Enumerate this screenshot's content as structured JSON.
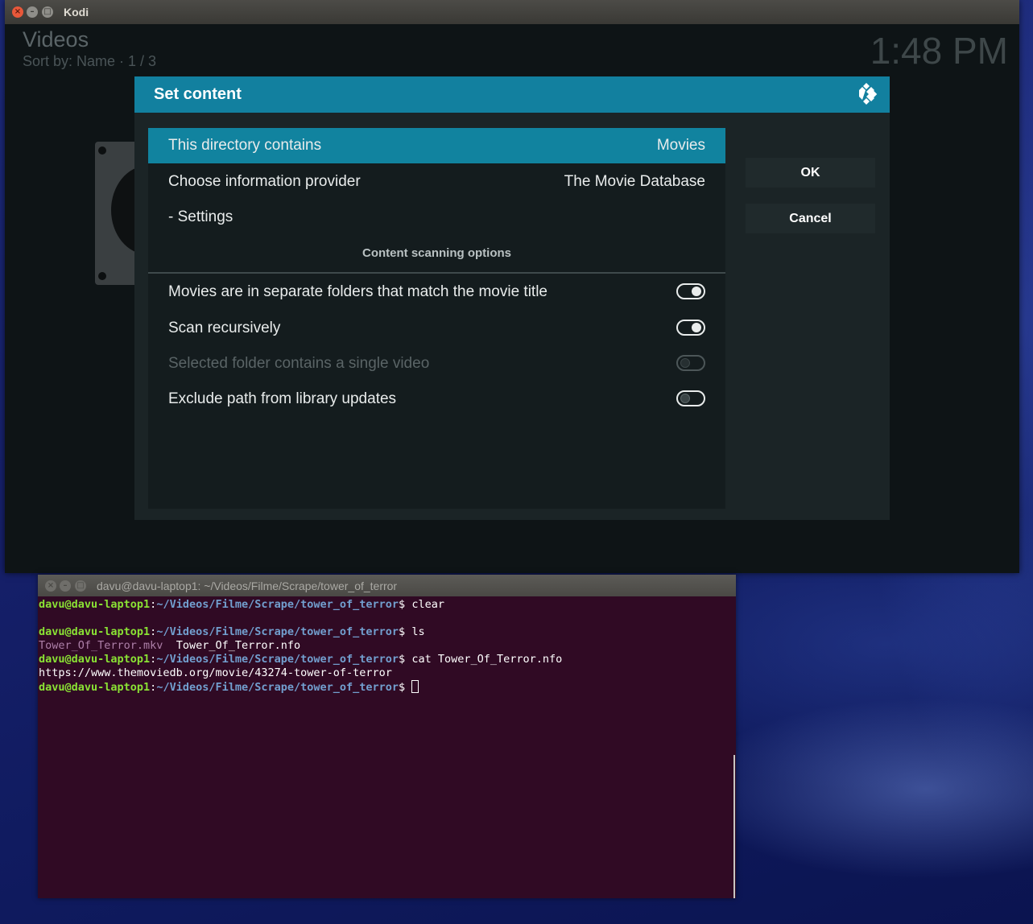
{
  "kodi": {
    "window_title": "Kodi",
    "background": {
      "heading": "Videos",
      "sort_info": "Sort by: Name  ·  1 / 3",
      "clock": "1:48 PM"
    },
    "dialog": {
      "title": "Set content",
      "rows": [
        {
          "label": "This directory contains",
          "value": "Movies"
        },
        {
          "label": "Choose information provider",
          "value": "The Movie Database"
        },
        {
          "label": "- Settings"
        }
      ],
      "section_title": "Content scanning options",
      "toggles": [
        {
          "label": "Movies are in separate folders that match the movie title",
          "state": "on"
        },
        {
          "label": "Scan recursively",
          "state": "on"
        },
        {
          "label": "Selected folder contains a single video",
          "state": "off",
          "disabled": true
        },
        {
          "label": "Exclude path from library updates",
          "state": "off"
        }
      ],
      "buttons": {
        "ok": "OK",
        "cancel": "Cancel"
      }
    }
  },
  "terminal": {
    "title": "davu@davu-laptop1: ~/Videos/Filme/Scrape/tower_of_terror",
    "user_host": "davu@davu-laptop1",
    "path": "~/Videos/Filme/Scrape/tower_of_terror",
    "lines": {
      "cmd1": "clear",
      "cmd2": "ls",
      "file_mkv": "Tower_Of_Terror.mkv",
      "file_nfo": "Tower_Of_Terror.nfo",
      "cmd3": "cat Tower_Of_Terror.nfo",
      "nfo_output": "https://www.themoviedb.org/movie/43274-tower-of-terror"
    }
  },
  "colors": {
    "kodi_accent": "#12809f",
    "terminal_bg": "#300a24",
    "prompt_user": "#8ae234",
    "prompt_path": "#729fcf"
  }
}
